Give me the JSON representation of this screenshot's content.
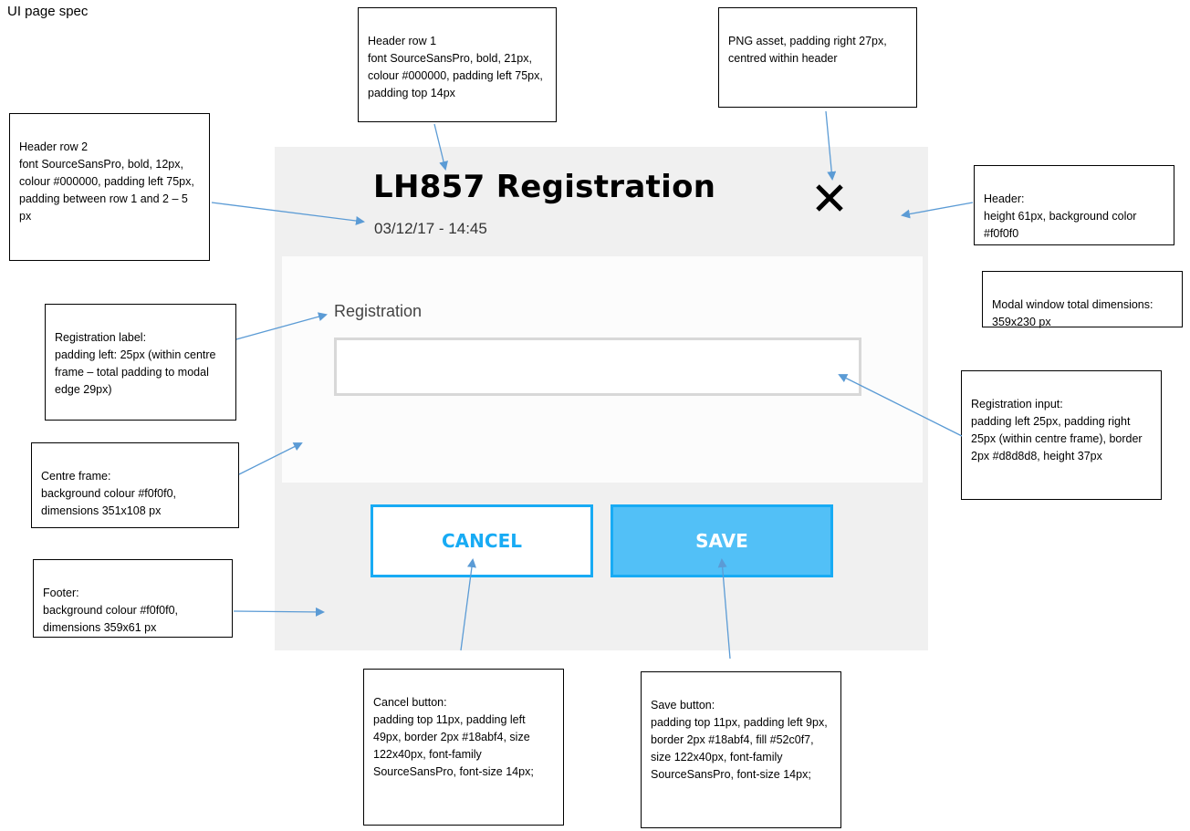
{
  "page_title": "UI page spec",
  "modal": {
    "title": "LH857 Registration",
    "subtitle": "03/12/17 - 14:45",
    "close_icon": "close-icon",
    "registration_label": "Registration",
    "registration_value": "",
    "cancel_label": "CANCEL",
    "save_label": "SAVE",
    "colors": {
      "background": "#f0f0f0",
      "input_border": "#d8d8d8",
      "button_border": "#18abf4",
      "save_fill": "#52c0f7"
    }
  },
  "annotations": {
    "header_row_1": "Header row 1\nfont SourceSansPro, bold, 21px, colour #000000, padding left 75px, padding top 14px",
    "png_asset": "PNG asset, padding right 27px, centred within header",
    "header_row_2": "Header row 2\nfont SourceSansPro, bold, 12px, colour #000000, padding left 75px, padding between row 1 and 2 – 5 px",
    "header": "Header:\nheight  61px, background color #f0f0f0",
    "modal_window": "Modal window total dimensions: 359x230 px",
    "registration_label": "Registration label:\npadding left: 25px (within centre frame – total padding to modal edge 29px)",
    "registration_input": "Registration input:\npadding left 25px, padding right 25px (within centre frame), border 2px #d8d8d8, height 37px",
    "centre_frame": "Centre frame:\nbackground colour #f0f0f0, dimensions 351x108 px",
    "footer": "Footer:\nbackground colour #f0f0f0, dimensions 359x61 px",
    "cancel_button": "Cancel button:\npadding top 11px, padding left 49px, border 2px #18abf4, size 122x40px, font-family SourceSansPro, font-size 14px;",
    "save_button": "Save button:\npadding top 11px, padding left 9px, border 2px #18abf4, fill #52c0f7, size 122x40px, font-family SourceSansPro,  font-size 14px;"
  }
}
